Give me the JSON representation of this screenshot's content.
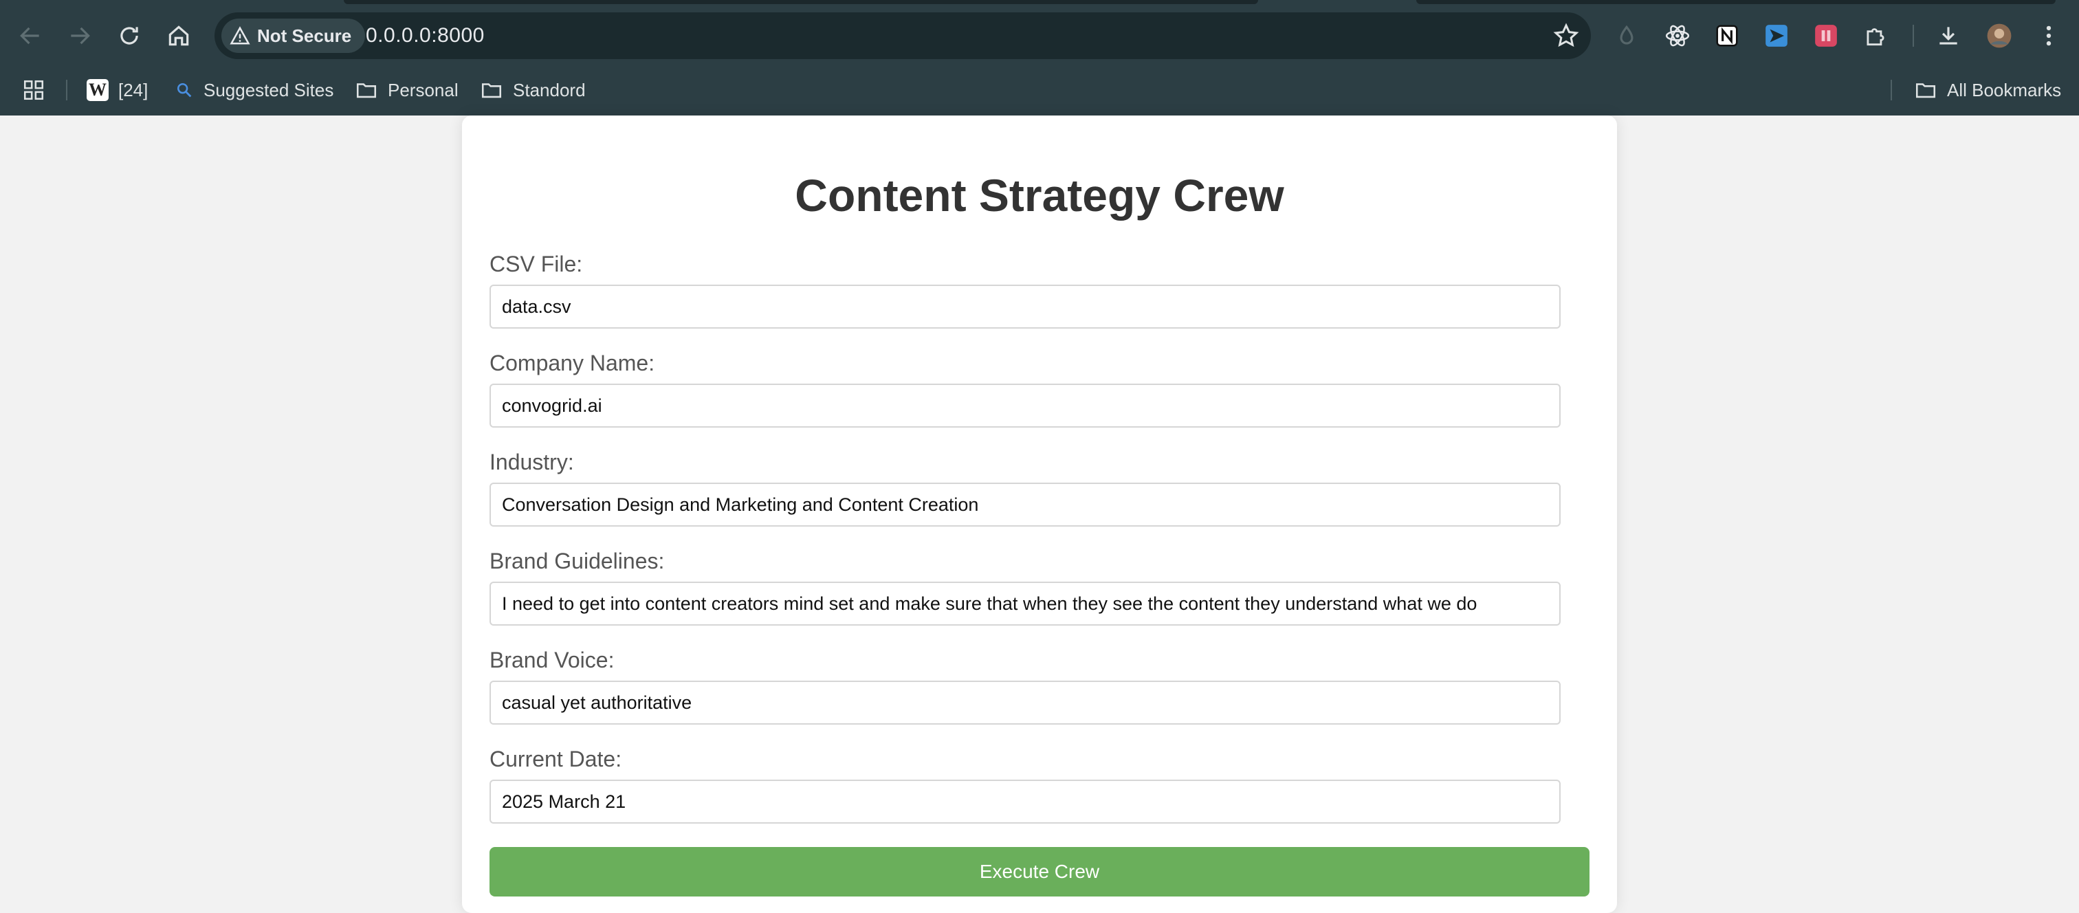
{
  "browser": {
    "security_label": "Not Secure",
    "url": "0.0.0.0:8000",
    "bookmarks": [
      {
        "label": "[24]",
        "icon": "wikipedia-icon"
      },
      {
        "label": "Suggested Sites",
        "icon": "search-icon"
      },
      {
        "label": "Personal",
        "icon": "folder-icon"
      },
      {
        "label": "Standord",
        "icon": "folder-icon"
      }
    ],
    "all_bookmarks_label": "All Bookmarks"
  },
  "page": {
    "title": "Content Strategy Crew",
    "fields": [
      {
        "label": "CSV File:",
        "value": "data.csv"
      },
      {
        "label": "Company Name:",
        "value": "convogrid.ai"
      },
      {
        "label": "Industry:",
        "value": "Conversation Design and Marketing and Content Creation"
      },
      {
        "label": "Brand Guidelines:",
        "value": "I need to get into content creators mind set and make sure that when they see the content they understand what we do"
      },
      {
        "label": "Brand Voice:",
        "value": "casual yet authoritative"
      },
      {
        "label": "Current Date:",
        "value": "2025 March 21"
      }
    ],
    "submit_label": "Execute Crew"
  },
  "colors": {
    "chrome": "#2c3e44",
    "button": "#6aaf5b",
    "title": "#333333",
    "label": "#555555"
  }
}
